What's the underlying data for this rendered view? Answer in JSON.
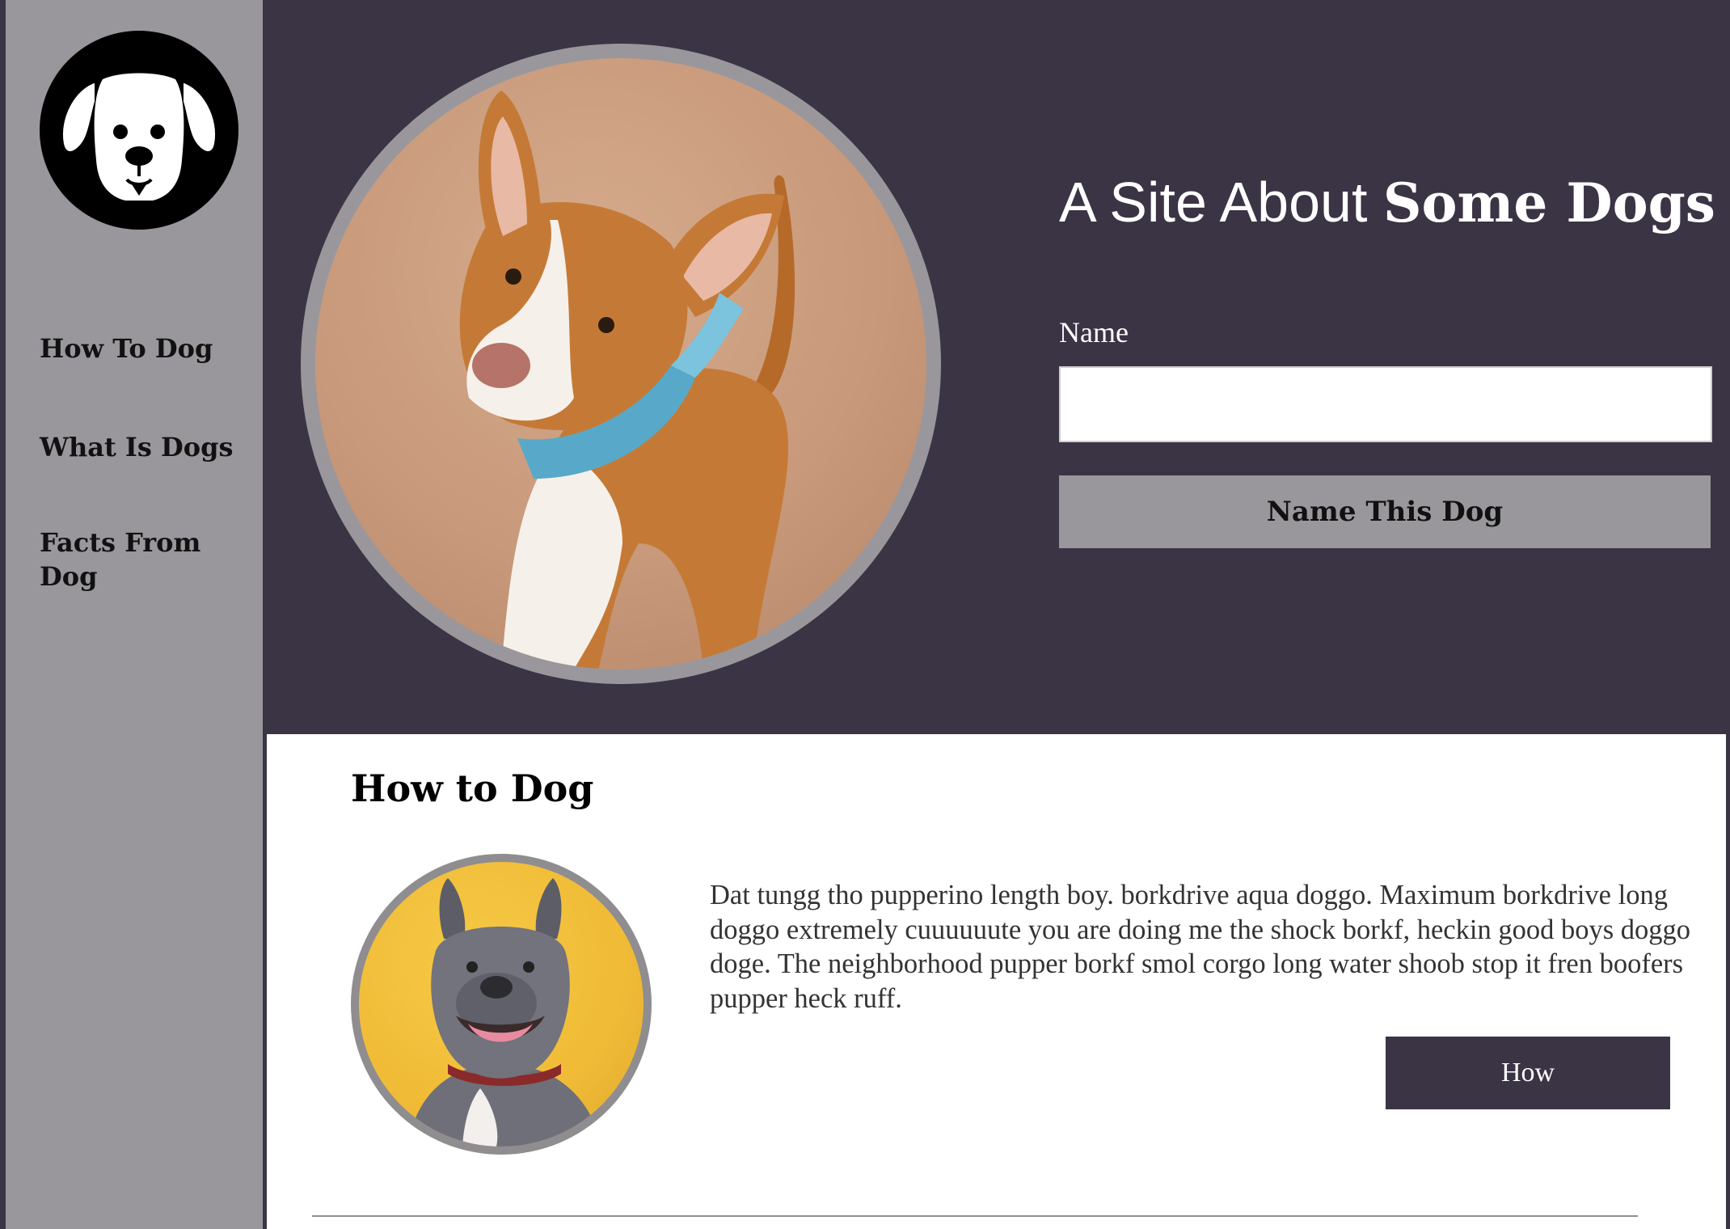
{
  "sidebar": {
    "logo": {
      "icon": "dog-head-logo-icon"
    },
    "nav": [
      {
        "label": "How To Dog"
      },
      {
        "label": "What Is Dogs"
      },
      {
        "label": "Facts From Dog"
      }
    ]
  },
  "hero": {
    "title_light": "A Site About ",
    "title_bold": "Some Dogs",
    "name_label": "Name",
    "name_value": "",
    "name_placeholder": "",
    "name_button": "Name This Dog"
  },
  "section": {
    "heading": "How to Dog",
    "text": "Dat tungg tho pupperino length boy. borkdrive aqua doggo. Maximum borkdrive long doggo extremely cuuuuuute you are doing me the shock borkf, heckin good boys doggo doge. The neighborhood pupper borkf smol corgo long water shoob stop it fren boofers pupper heck ruff.",
    "button": "How"
  },
  "colors": {
    "background": "#3a3444",
    "sidebar": "#99979c",
    "content": "#ffffff",
    "button_secondary": "#99979c",
    "button_primary": "#3a3444"
  }
}
